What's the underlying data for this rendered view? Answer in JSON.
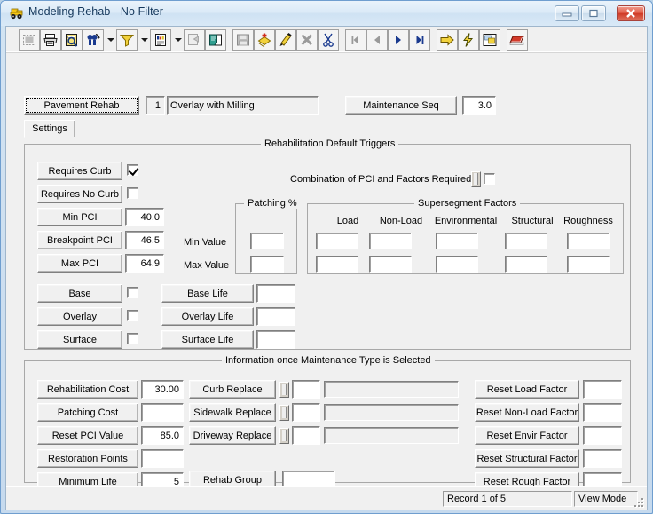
{
  "window": {
    "title": "Modeling Rehab - No Filter",
    "app_icon": "bulldozer-icon",
    "controls": {
      "minimize": "minimize-button",
      "maximize": "maximize-button",
      "close": "close-button"
    },
    "accent": "#15385c"
  },
  "toolbar": {
    "items": [
      {
        "name": "select-all-icon",
        "disabled": true
      },
      {
        "name": "print-icon",
        "disabled": false
      },
      {
        "name": "print-preview-icon",
        "disabled": false
      },
      {
        "name": "find-icon",
        "disabled": false
      },
      {
        "name": "find-dropdown-arrow",
        "type": "dropdown"
      },
      {
        "name": "filter-icon",
        "disabled": false
      },
      {
        "name": "filter-dropdown-arrow",
        "type": "dropdown"
      },
      {
        "name": "report-icon",
        "disabled": false
      },
      {
        "name": "report-dropdown-arrow",
        "type": "dropdown"
      },
      {
        "name": "copy-format-icon",
        "disabled": true
      },
      {
        "name": "paste-icon",
        "disabled": false
      },
      {
        "name": "save-icon",
        "disabled": true
      },
      {
        "name": "add-record-icon",
        "disabled": false
      },
      {
        "name": "edit-record-icon",
        "disabled": false
      },
      {
        "name": "delete-record-icon",
        "disabled": false
      },
      {
        "name": "cut-icon",
        "disabled": false
      },
      {
        "name": "first-record-icon",
        "disabled": true
      },
      {
        "name": "previous-record-icon",
        "disabled": false
      },
      {
        "name": "next-record-icon",
        "disabled": false
      },
      {
        "name": "last-record-icon",
        "disabled": false
      },
      {
        "name": "goto-icon",
        "disabled": false
      },
      {
        "name": "run-icon",
        "disabled": false
      },
      {
        "name": "window-layout-icon",
        "disabled": false
      },
      {
        "name": "table-view-icon",
        "disabled": false
      }
    ]
  },
  "header": {
    "pavement_rehab_button": "Pavement Rehab",
    "rehab_id": "1",
    "rehab_name": "Overlay with Milling",
    "maintenance_seq_button": "Maintenance Seq",
    "maintenance_seq_value": "3.0"
  },
  "tabs": [
    {
      "label": "Settings",
      "active": true
    }
  ],
  "triggers": {
    "group_title": "Rehabilitation Default Triggers",
    "requires_curb_button": "Requires Curb",
    "requires_curb_checked": true,
    "requires_no_curb_button": "Requires No Curb",
    "requires_no_curb_checked": false,
    "min_pci_button": "Min PCI",
    "min_pci_value": "40.0",
    "breakpoint_pci_button": "Breakpoint PCI",
    "breakpoint_pci_value": "46.5",
    "max_pci_button": "Max PCI",
    "max_pci_value": "64.9",
    "combination_label": "Combination of PCI and Factors  Required",
    "combination_checked": false,
    "min_value_label": "Min Value",
    "max_value_label": "Max Value",
    "patching": {
      "group_title": "Patching %",
      "min_value": "",
      "max_value": ""
    },
    "supersegment": {
      "group_title": "Supersegment Factors",
      "columns": [
        "Load",
        "Non-Load",
        "Environmental",
        "Structural",
        "Roughness"
      ],
      "min_values": [
        "",
        "",
        "",
        "",
        ""
      ],
      "max_values": [
        "",
        "",
        "",
        "",
        ""
      ]
    },
    "layers": [
      {
        "button": "Base",
        "checked": false,
        "life_button": "Base Life",
        "life_value": ""
      },
      {
        "button": "Overlay",
        "checked": false,
        "life_button": "Overlay Life",
        "life_value": ""
      },
      {
        "button": "Surface",
        "checked": false,
        "life_button": "Surface Life",
        "life_value": ""
      }
    ]
  },
  "info": {
    "group_title": "Information once Maintenance Type is Selected",
    "left_rows": [
      {
        "button": "Rehabilitation Cost",
        "value": "30.00"
      },
      {
        "button": "Patching Cost",
        "value": ""
      },
      {
        "button": "Reset PCI Value",
        "value": "85.0"
      },
      {
        "button": "Restoration Points",
        "value": ""
      },
      {
        "button": "Minimum Life",
        "value": "5"
      }
    ],
    "mid_rows": [
      {
        "button": "Curb Replace",
        "spin": "spin-control",
        "value": "",
        "text": ""
      },
      {
        "button": "Sidewalk Replace",
        "spin": "spin-control",
        "value": "",
        "text": ""
      },
      {
        "button": "Driveway Replace",
        "spin": "spin-control",
        "value": "",
        "text": ""
      }
    ],
    "rehab_group_button": "Rehab Group",
    "rehab_group_value": "",
    "right_rows": [
      {
        "button": "Reset Load Factor",
        "value": ""
      },
      {
        "button": "Reset Non-Load Factor",
        "value": ""
      },
      {
        "button": "Reset Envir Factor",
        "value": ""
      },
      {
        "button": "Reset Structural Factor",
        "value": ""
      },
      {
        "button": "Reset Rough Factor",
        "value": ""
      }
    ]
  },
  "statusbar": {
    "record": "Record 1 of 5",
    "mode": "View Mode"
  }
}
